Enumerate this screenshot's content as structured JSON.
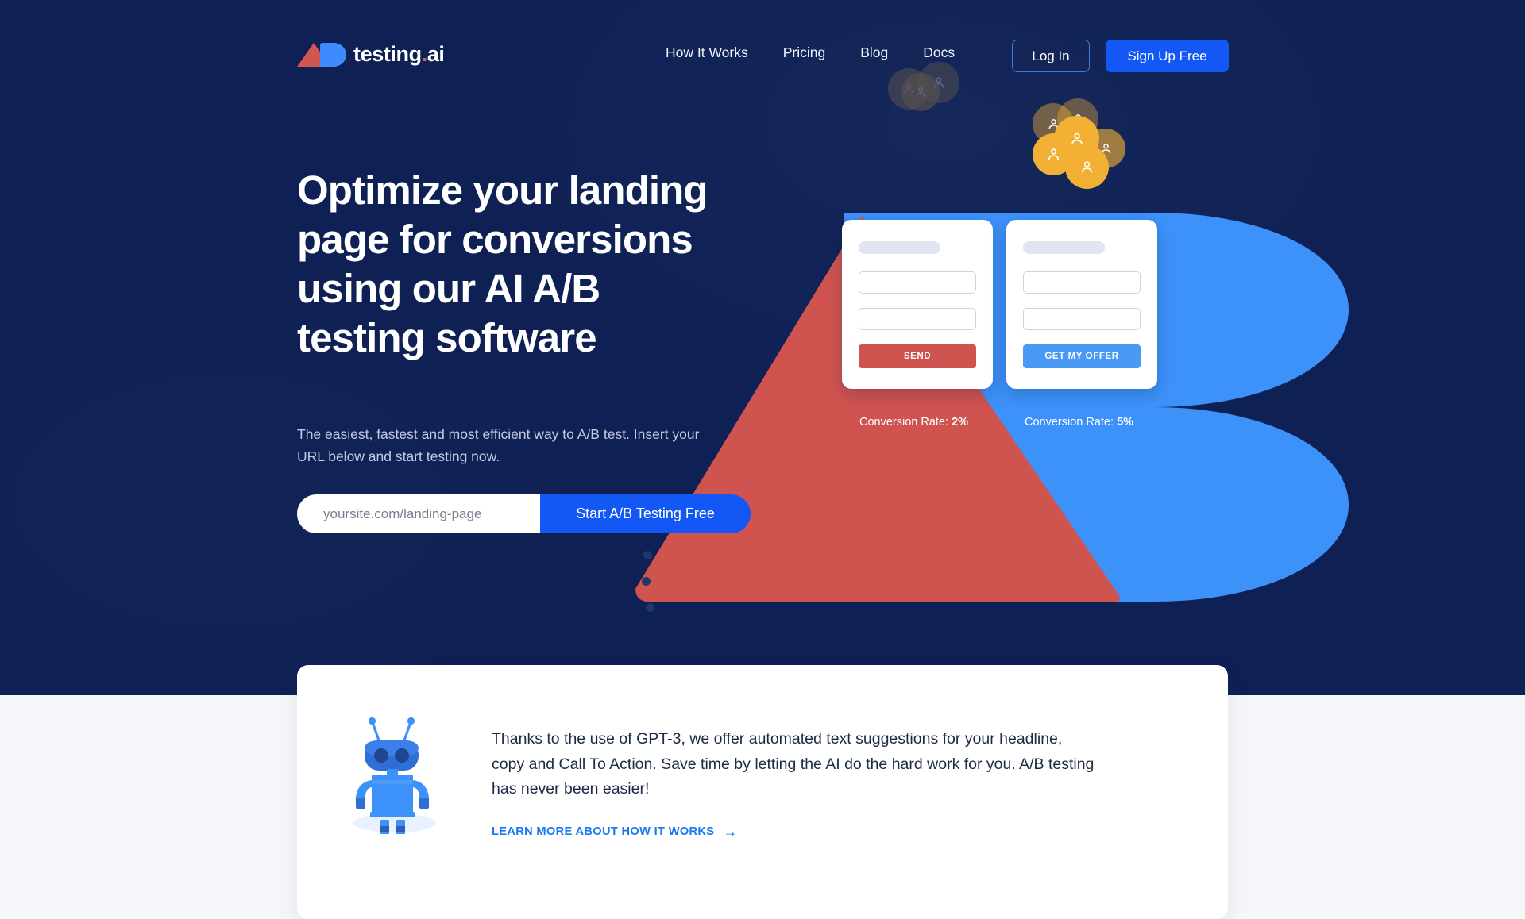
{
  "nav": {
    "logo": {
      "text_main": "testing",
      "text_dot": ".",
      "text_suffix": "ai",
      "icon_a": "triangle-a-logo",
      "icon_b": "rounded-b-logo"
    },
    "links": [
      {
        "label": "How It Works"
      },
      {
        "label": "Pricing"
      },
      {
        "label": "Blog"
      },
      {
        "label": "Docs"
      }
    ],
    "login_label": "Log In",
    "signup_label": "Sign Up Free"
  },
  "hero": {
    "headline": "Optimize your landing page for conversions using our AI A/B testing software",
    "subcopy": "The easiest, fastest and most efficient way to A/B test. Insert your URL below and start testing now.",
    "input_placeholder": "yoursite.com/landing-page",
    "input_value": "",
    "cta_label": "Start A/B Testing Free"
  },
  "variants": {
    "a": {
      "button_label": "SEND",
      "conversion_label": "Conversion Rate:",
      "conversion_value": "2%",
      "accent": "#cf5450"
    },
    "b": {
      "button_label": "GET MY OFFER",
      "conversion_label": "Conversion Rate:",
      "conversion_value": "5%",
      "accent": "#4a9af5"
    }
  },
  "info": {
    "paragraph": "Thanks to the use of GPT-3, we offer automated text suggestions for your headline, copy and Call To Action. Save time by letting the AI do the hard work for you. A/B testing has never been easier!",
    "link_label": "LEARN MORE ABOUT HOW IT WORKS",
    "link_arrow": "→"
  },
  "colors": {
    "background_navy": "#0e2054",
    "brand_blue": "#1358f5",
    "brand_red": "#cf5450",
    "shape_blue": "#3d92fa",
    "avatar_gold": "#f2b134",
    "page_background": "#f4f6f9"
  }
}
